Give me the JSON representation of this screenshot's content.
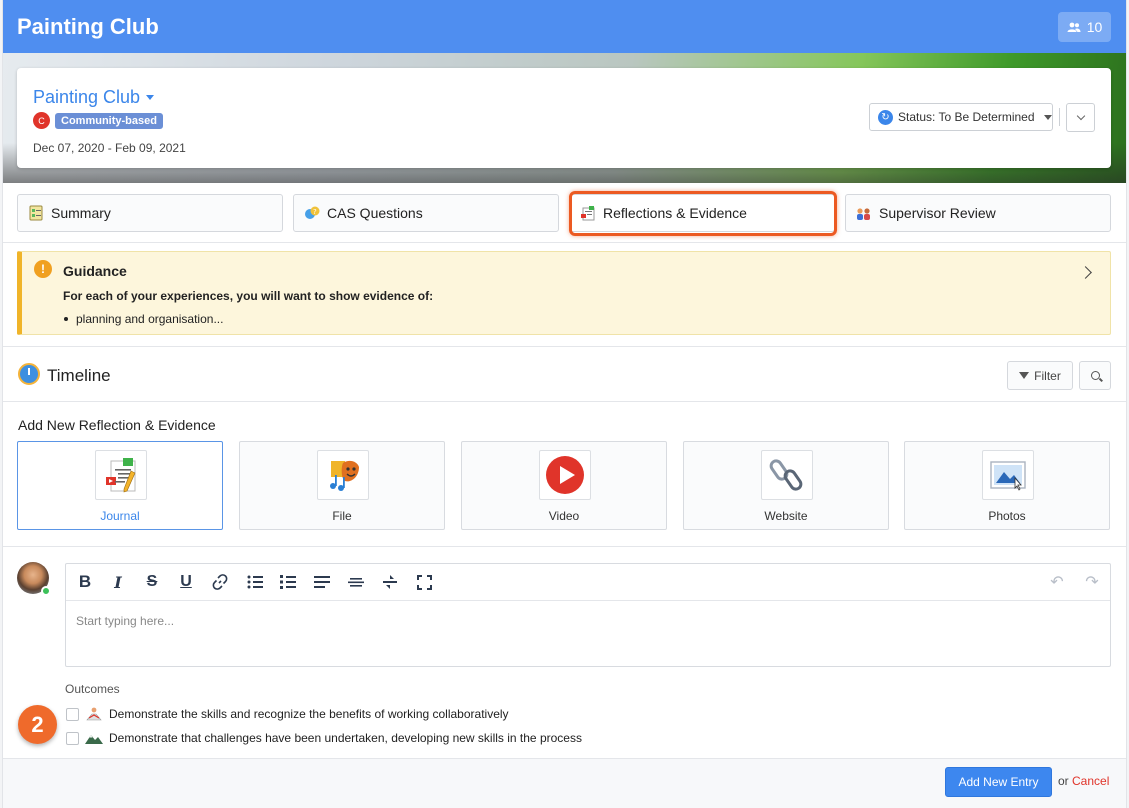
{
  "header": {
    "title": "Painting Club",
    "members_count": "10",
    "members_icon": "users-icon"
  },
  "club": {
    "name": "Painting Club",
    "category_initial": "C",
    "category": "Community-based",
    "dates": "Dec 07, 2020 - Feb 09, 2021",
    "status": "Status: To Be Determined"
  },
  "tabs": [
    {
      "label": "Summary",
      "icon": "summary-icon"
    },
    {
      "label": "CAS Questions",
      "icon": "questions-icon"
    },
    {
      "label": "Reflections & Evidence",
      "icon": "reflections-icon",
      "active": true
    },
    {
      "label": "Supervisor Review",
      "icon": "supervisor-icon"
    }
  ],
  "guidance": {
    "title": "Guidance",
    "text": "For each of your experiences, you will want to show evidence of:",
    "items": [
      "planning and organisation..."
    ]
  },
  "timeline": {
    "title": "Timeline",
    "filter_label": "Filter"
  },
  "add_new": {
    "title": "Add New Reflection & Evidence",
    "types": [
      {
        "label": "Journal",
        "icon": "journal-icon",
        "selected": true
      },
      {
        "label": "File",
        "icon": "file-icon"
      },
      {
        "label": "Video",
        "icon": "video-icon"
      },
      {
        "label": "Website",
        "icon": "website-icon"
      },
      {
        "label": "Photos",
        "icon": "photos-icon"
      }
    ]
  },
  "editor": {
    "placeholder": "Start typing here..."
  },
  "outcomes": {
    "label": "Outcomes",
    "items": [
      "Demonstrate the skills and recognize the benefits of working collaboratively",
      "Demonstrate that challenges have been undertaken, developing new skills in the process"
    ]
  },
  "step_badge": "2",
  "footer": {
    "submit_label": "Add New Entry",
    "or_text": "or",
    "cancel_label": "Cancel"
  },
  "colors": {
    "primary": "#4f8ef0",
    "accent_orange": "#ec5a22",
    "warning": "#f0b429",
    "danger": "#e0342a"
  }
}
